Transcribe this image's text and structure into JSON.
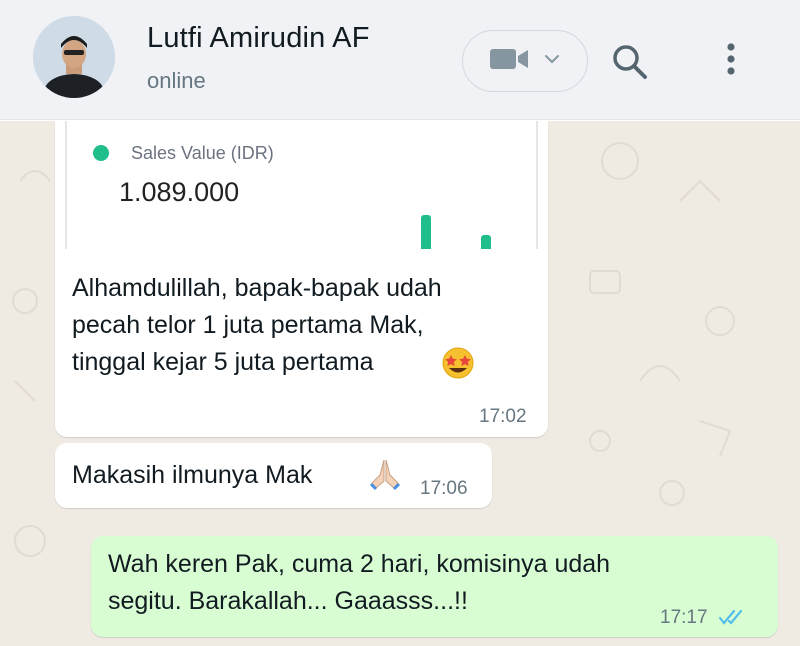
{
  "header": {
    "contact_name": "Lutfi Amirudin AF",
    "status": "online",
    "icons": [
      "video-call-icon",
      "chevron-down-icon",
      "search-icon",
      "more-menu-icon"
    ]
  },
  "messages": [
    {
      "direction": "incoming",
      "card": {
        "label": "Sales Value (IDR)",
        "value": "1.089.000"
      },
      "lines": [
        "Alhamdulillah, bapak-bapak udah",
        "pecah telor 1 juta pertama Mak,",
        "tinggal kejar 5 juta pertama"
      ],
      "emoji": "star-struck-emoji",
      "time": "17:02"
    },
    {
      "direction": "incoming",
      "text": "Makasih ilmunya Mak",
      "emoji": "folded-hands-emoji",
      "time": "17:06"
    },
    {
      "direction": "outgoing",
      "lines": [
        "Wah keren Pak, cuma 2 hari, komisinya udah",
        "segitu. Barakallah... Gaaasss...!!"
      ],
      "time": "17:17",
      "status": "read"
    }
  ],
  "colors": {
    "header_bg": "#f0f2f5",
    "chat_bg": "#efeae2",
    "outgoing_bubble": "#d9fdd3",
    "accent_green": "#1fbe8c",
    "read_tick": "#53bdeb"
  }
}
